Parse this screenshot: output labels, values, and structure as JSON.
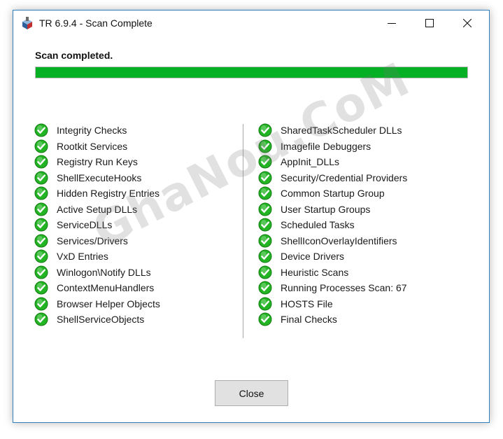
{
  "window": {
    "title": "TR 6.9.4 - Scan Complete"
  },
  "status": {
    "heading": "Scan completed.",
    "progress_percent": 100
  },
  "checks_left": [
    {
      "label": "Integrity Checks"
    },
    {
      "label": "Rootkit Services"
    },
    {
      "label": "Registry Run Keys"
    },
    {
      "label": "ShellExecuteHooks"
    },
    {
      "label": "Hidden Registry Entries"
    },
    {
      "label": "Active Setup DLLs"
    },
    {
      "label": "ServiceDLLs"
    },
    {
      "label": "Services/Drivers"
    },
    {
      "label": "VxD Entries"
    },
    {
      "label": "Winlogon\\Notify DLLs"
    },
    {
      "label": "ContextMenuHandlers"
    },
    {
      "label": "Browser Helper Objects"
    },
    {
      "label": "ShellServiceObjects"
    }
  ],
  "checks_right": [
    {
      "label": "SharedTaskScheduler DLLs"
    },
    {
      "label": "Imagefile Debuggers"
    },
    {
      "label": "AppInit_DLLs"
    },
    {
      "label": "Security/Credential Providers"
    },
    {
      "label": "Common Startup Group"
    },
    {
      "label": "User Startup Groups"
    },
    {
      "label": "Scheduled Tasks"
    },
    {
      "label": "ShellIconOverlayIdentifiers"
    },
    {
      "label": "Device Drivers"
    },
    {
      "label": "Heuristic Scans"
    },
    {
      "label": "Running Processes Scan: 67"
    },
    {
      "label": "HOSTS File"
    },
    {
      "label": "Final Checks"
    }
  ],
  "footer": {
    "close_label": "Close"
  },
  "watermark": {
    "text": "GhaNou.CoM"
  },
  "colors": {
    "progress": "#06b025",
    "check_green": "#22b422",
    "window_border": "#2f7fbf"
  },
  "icons": {
    "app": "toolbox-app-icon",
    "check": "check-circle-icon"
  }
}
